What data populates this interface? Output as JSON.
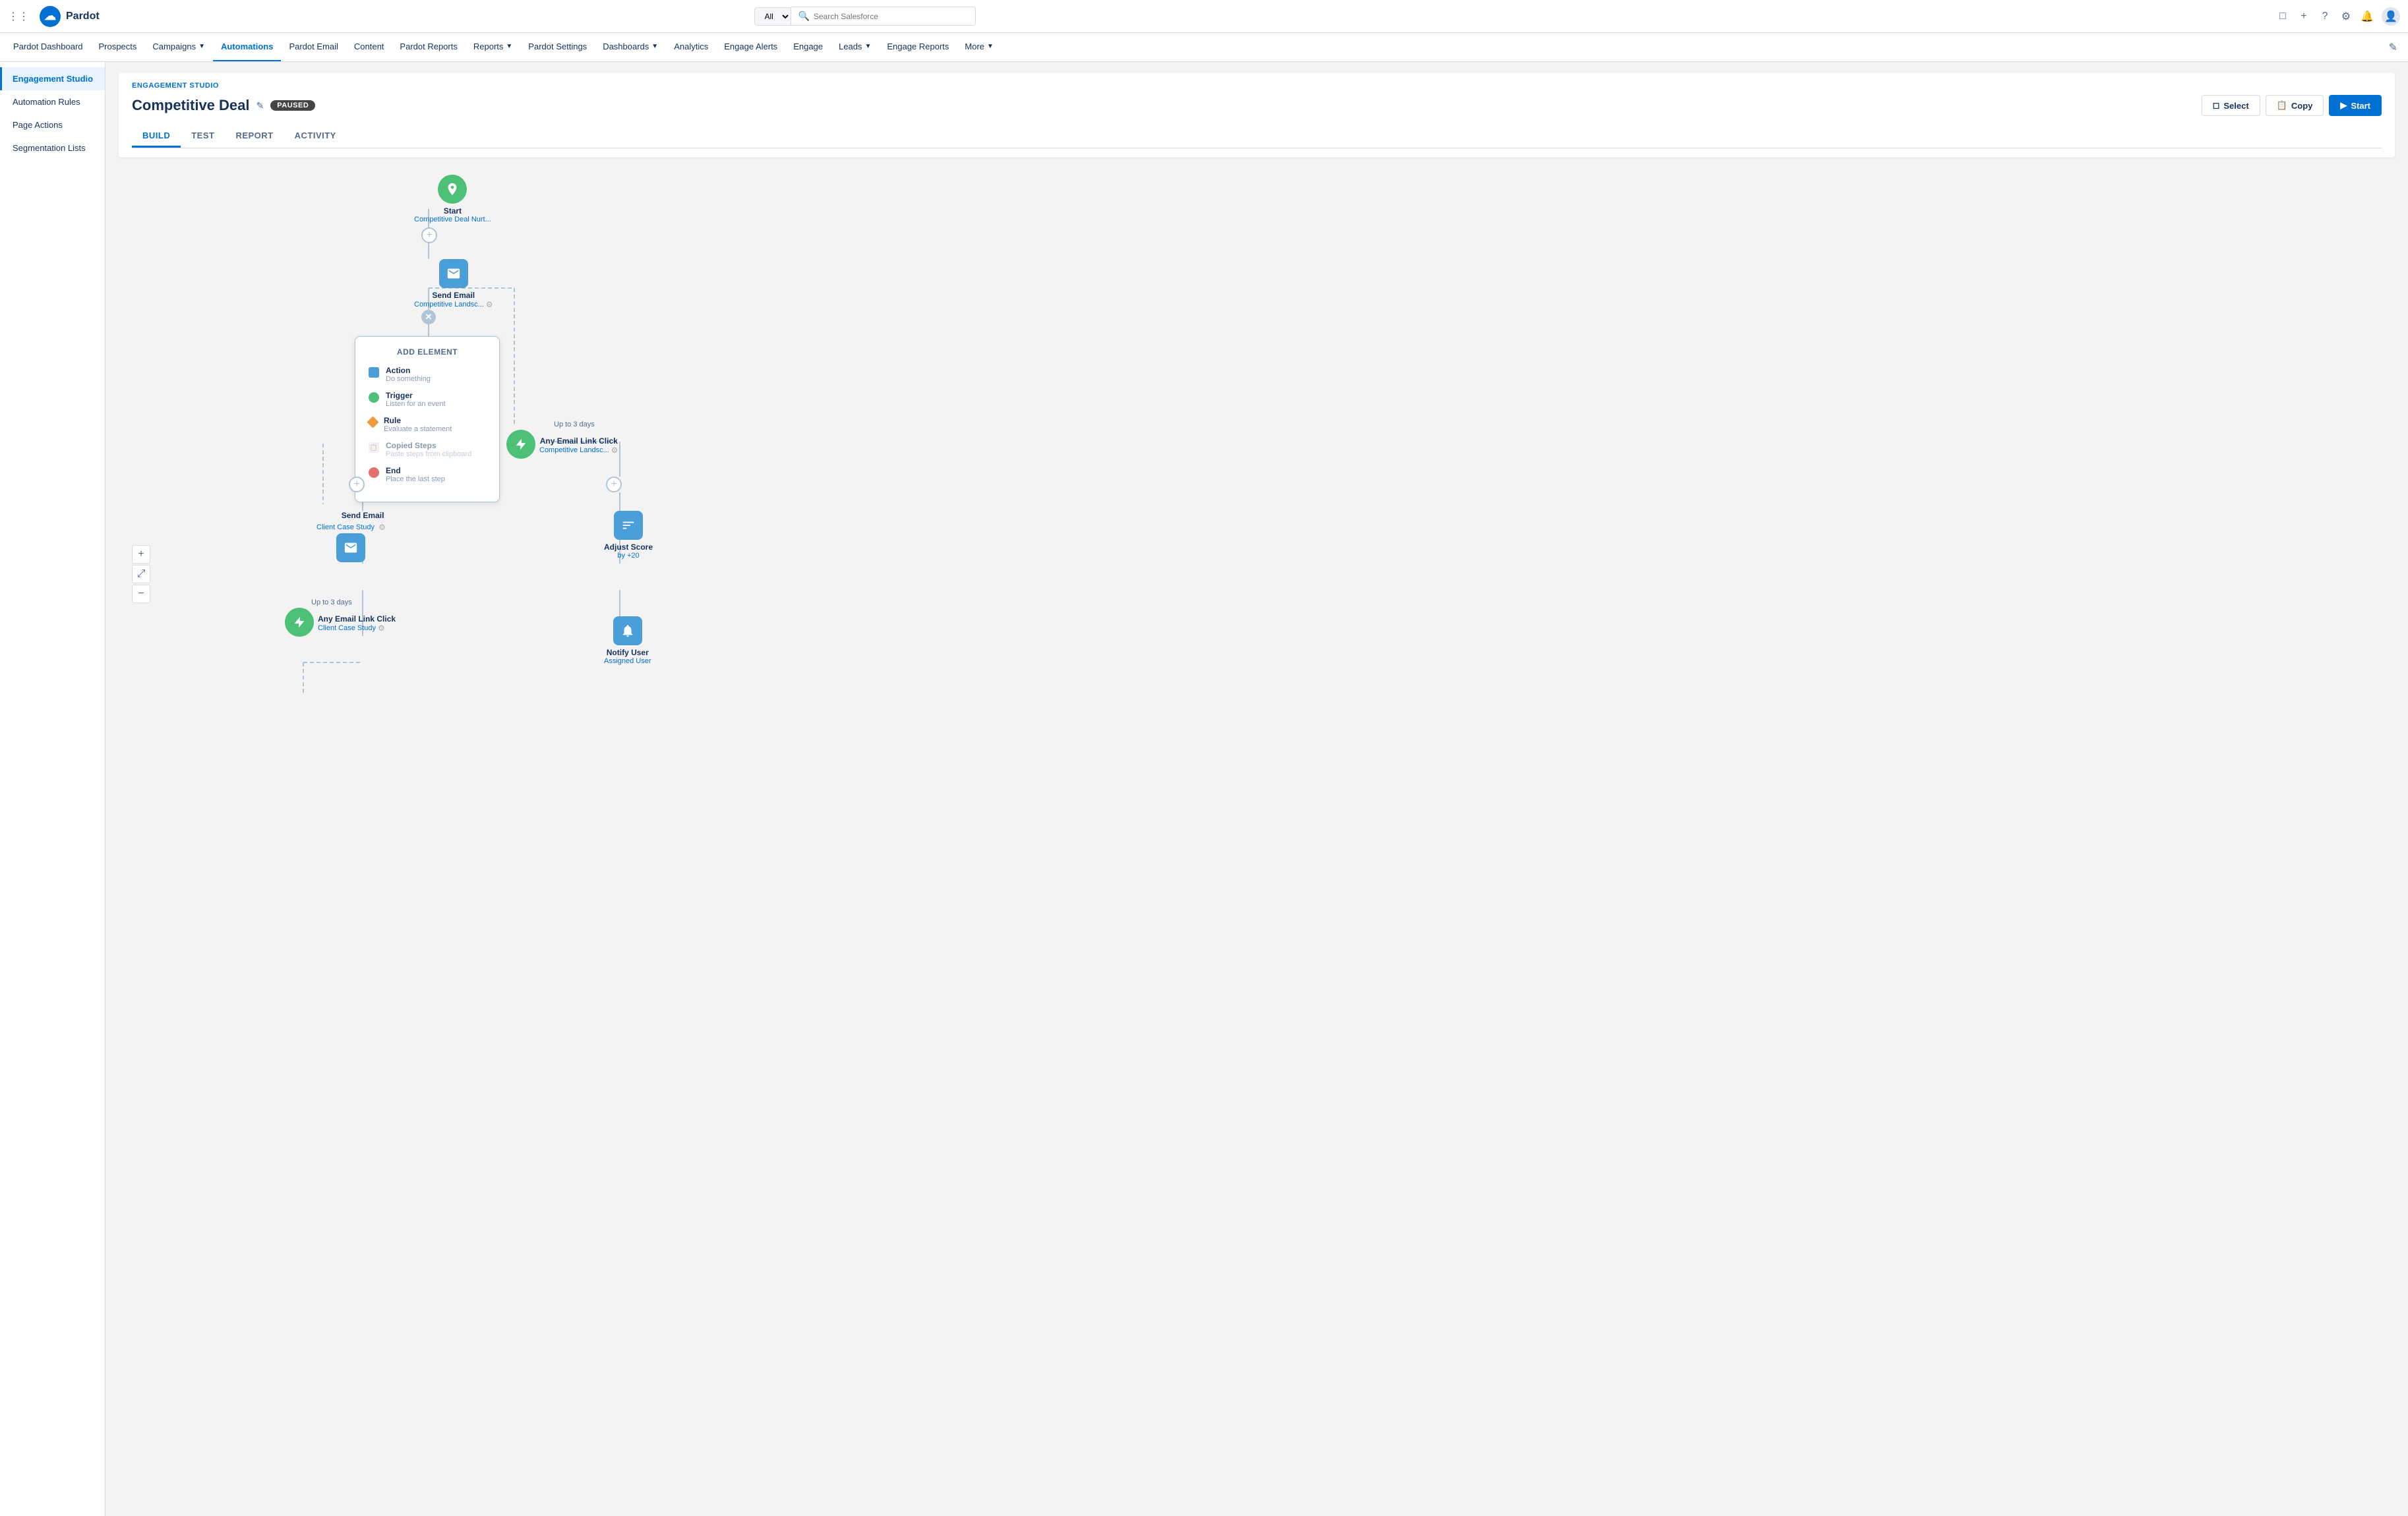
{
  "topNav": {
    "logo": "☁",
    "appName": "Pardot",
    "searchPlaceholder": "Search Salesforce",
    "searchType": "All",
    "navItems": [
      {
        "label": "Pardot Dashboard",
        "active": false
      },
      {
        "label": "Prospects",
        "active": false
      },
      {
        "label": "Campaigns",
        "active": false,
        "hasDropdown": true
      },
      {
        "label": "Automations",
        "active": true
      },
      {
        "label": "Pardot Email",
        "active": false
      },
      {
        "label": "Content",
        "active": false
      },
      {
        "label": "Pardot Reports",
        "active": false
      },
      {
        "label": "Reports",
        "active": false,
        "hasDropdown": true
      },
      {
        "label": "Pardot Settings",
        "active": false
      },
      {
        "label": "Dashboards",
        "active": false,
        "hasDropdown": true
      },
      {
        "label": "Analytics",
        "active": false
      },
      {
        "label": "Engage Alerts",
        "active": false
      },
      {
        "label": "Engage",
        "active": false
      },
      {
        "label": "Leads",
        "active": false,
        "hasDropdown": true
      },
      {
        "label": "Engage Reports",
        "active": false
      },
      {
        "label": "More",
        "active": false,
        "hasDropdown": true
      }
    ]
  },
  "sidebar": {
    "items": [
      {
        "label": "Engagement Studio",
        "active": true
      },
      {
        "label": "Automation Rules",
        "active": false
      },
      {
        "label": "Page Actions",
        "active": false
      },
      {
        "label": "Segmentation Lists",
        "active": false
      }
    ]
  },
  "page": {
    "breadcrumb": "ENGAGEMENT STUDIO",
    "title": "Competitive Deal",
    "badge": "PAUSED",
    "tabs": [
      {
        "label": "BUILD",
        "active": true
      },
      {
        "label": "TEST",
        "active": false
      },
      {
        "label": "REPORT",
        "active": false
      },
      {
        "label": "ACTIVITY",
        "active": false
      }
    ],
    "actions": {
      "select": "Select",
      "copy": "Copy",
      "start": "Start"
    }
  },
  "flow": {
    "startNode": {
      "label": "Start",
      "sublabel": "Competitive Deal Nurt..."
    },
    "sendEmailNode1": {
      "label": "Send Email",
      "sublabel": "Competitive Landsc..."
    },
    "addElement": {
      "title": "ADD ELEMENT",
      "items": [
        {
          "type": "action",
          "label": "Action",
          "sublabel": "Do something"
        },
        {
          "type": "trigger",
          "label": "Trigger",
          "sublabel": "Listen for an event"
        },
        {
          "type": "rule",
          "label": "Rule",
          "sublabel": "Evaluate a statement"
        },
        {
          "type": "copied",
          "label": "Copied Steps",
          "sublabel": "Paste steps from clipboard"
        },
        {
          "type": "end",
          "label": "End",
          "sublabel": "Place the last step"
        }
      ]
    },
    "triggerNode1": {
      "upToLabel": "Up to 3 days",
      "label": "Any Email Link Click",
      "sublabel": "Competitive Landsc..."
    },
    "sendEmailNode2": {
      "label": "Send Email",
      "sublabel": "Client Case Study"
    },
    "adjustScoreNode": {
      "label": "Adjust Score",
      "sublabel": "by +20"
    },
    "triggerNode2": {
      "upToLabel": "Up to 3 days",
      "label": "Any Email Link Click",
      "sublabel": "Client Case Study"
    },
    "notifyUserNode": {
      "label": "Notify User",
      "sublabel": "Assigned User"
    }
  },
  "zoom": {
    "plus": "+",
    "fit": "⤢",
    "minus": "−"
  }
}
